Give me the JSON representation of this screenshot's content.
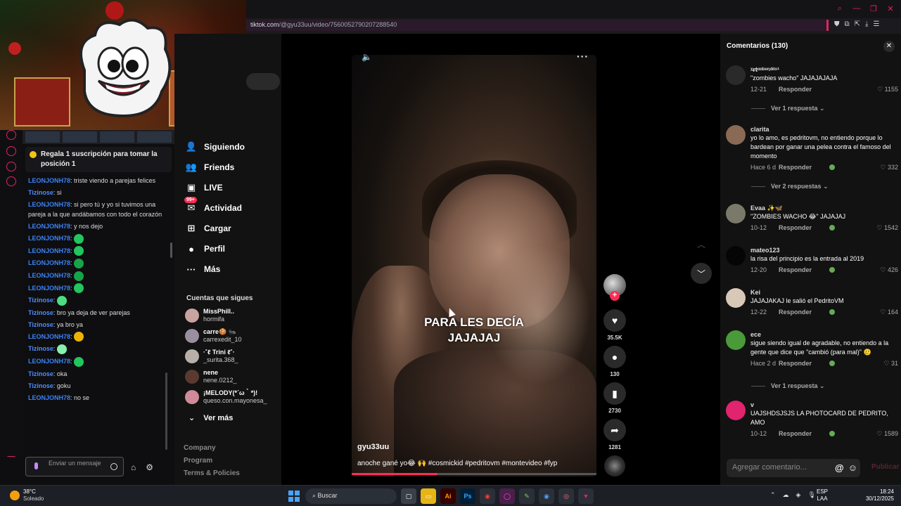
{
  "browser": {
    "url_host": "tiktok.com",
    "url_path": "/@gyu33uu/video/7560052790207288540"
  },
  "stream_chat": {
    "pinned": "Regala 1 suscripción para tomar la posición 1",
    "messages": [
      {
        "user": "LEONJONH78",
        "text": "triste viendo a parejas felices",
        "color": "#3b82f6"
      },
      {
        "user": "Tizinose",
        "text": "si",
        "color": "#4f8cff"
      },
      {
        "user": "LEONJONH78",
        "text": "si pero tú y yo si tuvimos una pareja a la que andábamos con todo el corazón",
        "color": "#3b82f6"
      },
      {
        "user": "LEONJONH78",
        "text": "y nos dejo",
        "color": "#3b82f6"
      },
      {
        "user": "LEONJONH78",
        "text": "",
        "emote": "#22c55e",
        "color": "#3b82f6"
      },
      {
        "user": "LEONJONH78",
        "text": "",
        "emote": "#22c55e",
        "color": "#3b82f6"
      },
      {
        "user": "LEONJONH78",
        "text": "",
        "emote": "#16a34a",
        "color": "#3b82f6"
      },
      {
        "user": "LEONJONH78",
        "text": "",
        "emote": "#16a34a",
        "color": "#3b82f6"
      },
      {
        "user": "LEONJONH78",
        "text": "",
        "emote": "#22c55e",
        "color": "#3b82f6"
      },
      {
        "user": "Tizinose",
        "text": "",
        "emote": "#4ade80",
        "color": "#4f8cff"
      },
      {
        "user": "Tizinose",
        "text": "bro ya deja de ver parejas",
        "color": "#4f8cff"
      },
      {
        "user": "Tizinose",
        "text": "ya bro ya",
        "color": "#4f8cff"
      },
      {
        "user": "LEONJONH78",
        "text": "",
        "emote": "#eab308",
        "color": "#3b82f6"
      },
      {
        "user": "Tizinose",
        "text": "",
        "emote": "#86efac",
        "color": "#4f8cff"
      },
      {
        "user": "LEONJONH78",
        "text": "",
        "emote": "#22c55e",
        "color": "#3b82f6"
      },
      {
        "user": "Tizinose",
        "text": "oka",
        "color": "#4f8cff"
      },
      {
        "user": "Tizinose",
        "text": "goku",
        "color": "#4f8cff"
      },
      {
        "user": "LEONJONH78",
        "text": "no se",
        "color": "#3b82f6"
      }
    ],
    "input_placeholder": "Enviar un mensaje"
  },
  "tiktok_nav": {
    "items": [
      {
        "label": "Siguiendo",
        "icon": "following-icon"
      },
      {
        "label": "Friends",
        "icon": "friends-icon"
      },
      {
        "label": "LIVE",
        "icon": "live-icon"
      },
      {
        "label": "Actividad",
        "icon": "activity-icon",
        "badge": "99+"
      },
      {
        "label": "Cargar",
        "icon": "upload-icon"
      },
      {
        "label": "Perfil",
        "icon": "profile-icon"
      },
      {
        "label": "Más",
        "icon": "more-icon"
      }
    ],
    "following_title": "Cuentas que sigues",
    "following": [
      {
        "name": "MissPhill..",
        "handle": "hormifa",
        "color": "#c9a3a0"
      },
      {
        "name": "carre🍪 🐜",
        "handle": "carrexedit_10",
        "color": "#9a8f9f"
      },
      {
        "name": "·˚ℓ Trini ℓ˚·",
        "handle": "_surita.368_",
        "color": "#b8b0a8"
      },
      {
        "name": "nene",
        "handle": "nene.0212_",
        "color": "#5a3a30"
      },
      {
        "name": "¡MELODY(*´ω｀*)!",
        "handle": "queso.con.mayonesa_",
        "color": "#d08a9a"
      }
    ],
    "see_more": "Ver más",
    "footer": [
      "Company",
      "Program",
      "Terms & Policies"
    ]
  },
  "video": {
    "caption_line1": "PARA LES DECÍA",
    "caption_line2": "JAJAJAJ",
    "username": "gyu33uu",
    "description": "anoche gané yo😂 🙌 #cosmickid #pedritovm #montevideo #fyp",
    "progress": 0.35,
    "likes": "35.5K",
    "comments": "130",
    "saves": "2730",
    "shares": "1281"
  },
  "comments_panel": {
    "title": "Comentarios (130)",
    "comments": [
      {
        "user": "ᵡᵲᵵᵅᵅᵇᵉᶯᵈᶦᵗᵒ¹",
        "text": "\"zombies wacho\" JAJAJAJAJA",
        "date": "12-21",
        "likes": "1155",
        "replies": "Ver 1 respuesta",
        "color": "#2a2a2a",
        "liked": false
      },
      {
        "user": "clarita",
        "text": "yo lo amo, es pedritovm, no entiendo porque lo bardean por ganar una pelea contra el famoso del momento",
        "date": "Hace 6 d",
        "likes": "332",
        "replies": "Ver 2 respuestas",
        "color": "#8a6a55",
        "liked": true
      },
      {
        "user": "Evaa ✨🦋",
        "text": "\"ZOMBIES WACHO 😂\" JAJAJAJ",
        "date": "10-12",
        "likes": "1542",
        "replies": "",
        "color": "#7a7a6a",
        "liked": true
      },
      {
        "user": "mateo123",
        "text": "la risa del principio es la entrada al 2019",
        "date": "12-20",
        "likes": "426",
        "replies": "",
        "color": "#050505",
        "liked": true
      },
      {
        "user": "Kei",
        "text": "JAJAJAKAJ le salió el PedritoVM",
        "date": "12-22",
        "likes": "164",
        "replies": "",
        "color": "#d8c8b8",
        "liked": true
      },
      {
        "user": "ece",
        "text": "sigue siendo igual de agradable, no entiendo a la gente que dice que \"cambió (para mal)\" 🥲",
        "date": "Hace 2 d",
        "likes": "31",
        "replies": "Ver 1 respuesta",
        "color": "#4a9a3a",
        "liked": true
      },
      {
        "user": "v",
        "text": "UAJSHDSJSJS LA PHOTOCARD DE PEDRITO, AMO",
        "date": "10-12",
        "likes": "1589",
        "replies": "",
        "color": "#e0246e",
        "liked": true
      }
    ],
    "reply_label": "Responder",
    "input_placeholder": "Agregar comentario...",
    "publish": "Publicar"
  },
  "taskbar": {
    "temp": "38°C",
    "weather": "Soleado",
    "search": "Buscar",
    "lang1": "ESP",
    "lang2": "LAA",
    "time": "18:24",
    "date": "30/12/2025"
  }
}
